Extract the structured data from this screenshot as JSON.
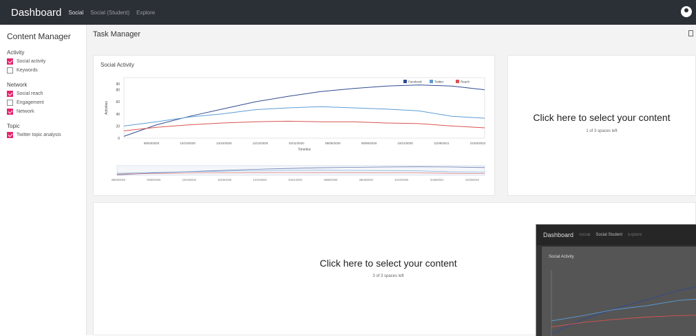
{
  "topbar": {
    "brand": "Dashboard",
    "nav": [
      "Social",
      "Social (Student)",
      "Explore"
    ]
  },
  "sidebar": {
    "title": "Content Manager",
    "groups": [
      {
        "label": "Activity",
        "items": [
          {
            "label": "Social activity",
            "checked": true
          },
          {
            "label": "Keywords",
            "checked": false
          }
        ]
      },
      {
        "label": "Network",
        "items": [
          {
            "label": "Social reach",
            "checked": true
          },
          {
            "label": "Engagement",
            "checked": false
          },
          {
            "label": "Network",
            "checked": true
          }
        ]
      },
      {
        "label": "Topic",
        "items": [
          {
            "label": "Twitter topic analysis",
            "checked": true
          }
        ]
      }
    ]
  },
  "main": {
    "title": "Task Manager",
    "chart_card_title": "Social Activity",
    "slot1": {
      "title": "Click here to select your content",
      "subtitle": "1 of 3 spaces left"
    },
    "slot2": {
      "title": "Click here to select your content",
      "subtitle": "3 of 3 spaces left"
    }
  },
  "colors": {
    "accent": "#e5246f",
    "topbar": "#2b2f36",
    "facebook": "#2e4a8f",
    "twitter": "#5b9bd5",
    "reach": "#d9534f"
  },
  "chart_data": {
    "type": "line",
    "title": "",
    "xlabel": "Timeline",
    "ylabel": "Activities",
    "ylim": [
      0,
      100
    ],
    "y_ticks": [
      0,
      20,
      40,
      60,
      80,
      90
    ],
    "x": [
      "08/03/2020",
      "10/10/2020",
      "12/10/2020",
      "12/12/2020",
      "03/11/2020",
      "08/05/2020",
      "08/06/2020",
      "10/12/2020",
      "11/08/2021",
      "21/03/2022"
    ],
    "series": [
      {
        "name": "Facebook",
        "color": "#2e4a8f",
        "values": [
          3,
          22,
          36,
          48,
          60,
          69,
          77,
          82,
          86,
          88,
          86,
          80
        ]
      },
      {
        "name": "Twitter",
        "color": "#5b9bd5",
        "values": [
          20,
          27,
          35,
          40,
          47,
          50,
          52,
          50,
          48,
          45,
          36,
          33
        ]
      },
      {
        "name": "Reach",
        "color": "#d9534f",
        "values": [
          12,
          18,
          22,
          25,
          27,
          28,
          27,
          27,
          25,
          24,
          20,
          17
        ]
      }
    ],
    "legend": "top-right",
    "navigator_labels": [
      "08/03/2020",
      "09/03/2020",
      "10/10/2020",
      "10/10/2020",
      "12/10/2020",
      "03/11/2020",
      "08/05/2020",
      "08/06/2020",
      "10/12/2020",
      "11/08/2021",
      "21/03/2022"
    ]
  },
  "inset": {
    "brand": "Dashboard",
    "nav": [
      "Social",
      "Social Student",
      "Explore"
    ],
    "card_title": "Social Activity"
  }
}
